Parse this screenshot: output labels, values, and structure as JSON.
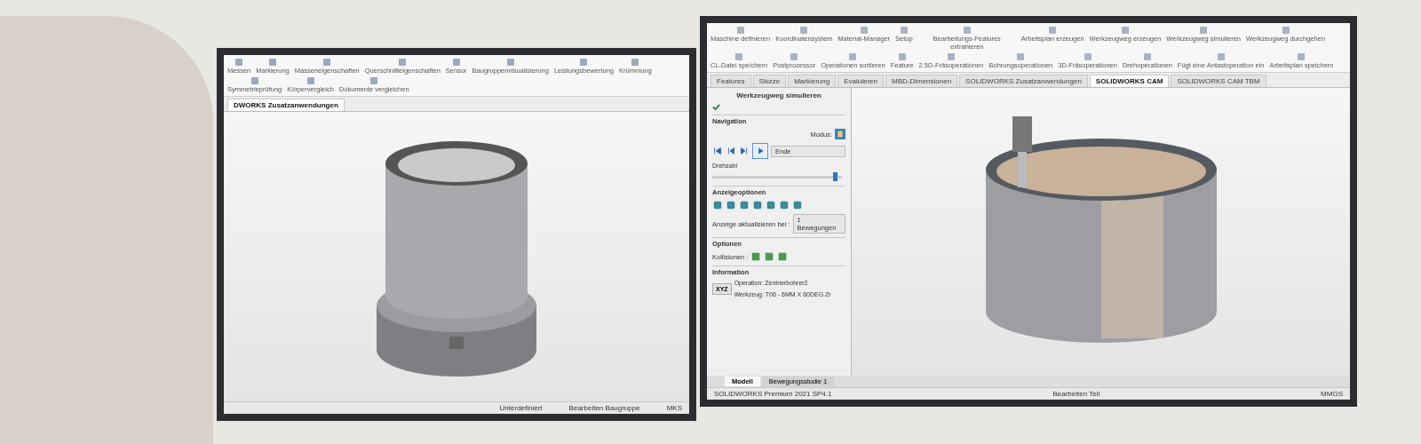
{
  "left_monitor": {
    "toolbar": [
      "Messen",
      "Markierung",
      "Masseneigenschaften",
      "Querschnitteigenschaften",
      "Sensor",
      "Baugruppenvisualisierung",
      "Leistungsbewertung",
      "Krümmung",
      "Symmetrieprüfung",
      "Körpervergleich",
      "Dokumente vergleichen"
    ],
    "tabs": [
      {
        "label": "DWORKS Zusatzanwendungen",
        "selected": true
      }
    ],
    "status_bar": [
      "Unterdefiniert",
      "Bearbeiten Baugruppe",
      "MKS"
    ]
  },
  "right_monitor": {
    "toolbar": [
      "Maschine definieren",
      "Koordinatensystem",
      "Material-Manager",
      "Setup",
      "Bearbeitungs-Features extrahieren",
      "Arbeitsplan erzeugen",
      "Werkzeugweg erzeugen",
      "Werkzeugweg simulieren",
      "Werkzeugweg durchgehen",
      "CL-Datei speichern",
      "Postprozessor",
      "Operationen sortieren",
      "Feature",
      "2.5D-Fräsoperationen",
      "Bohrungsoperationen",
      "3D-Fräsoperationen",
      "Drehoperationen",
      "Fügt eine Antastoperation ein",
      "Arbeitsplan speichern"
    ],
    "tabs": [
      {
        "label": "Features",
        "selected": false
      },
      {
        "label": "Skizze",
        "selected": false
      },
      {
        "label": "Markierung",
        "selected": false
      },
      {
        "label": "Evaluieren",
        "selected": false
      },
      {
        "label": "MBD-Dimensionen",
        "selected": false
      },
      {
        "label": "SOLIDWORKS Zusatzanwendungen",
        "selected": false
      },
      {
        "label": "SOLIDWORKS CAM",
        "selected": true
      },
      {
        "label": "SOLIDWORKS CAM TBM",
        "selected": false
      }
    ],
    "panel": {
      "title": "Werkzeugweg simulieren",
      "navigation": {
        "heading": "Navigation",
        "mode_label": "Modus:",
        "dropdown": "Ende",
        "speed_label": "Drehzahl",
        "speed": {
          "level": 0.95
        }
      },
      "display": {
        "heading": "Anzeigeoptionen",
        "update_label": "Anzeige aktualisieren bei :",
        "update_value": "1 Bewegungen"
      },
      "options": {
        "heading": "Optionen",
        "collisions_label": "Kollisionen :"
      },
      "information": {
        "heading": "Information",
        "xyz_button": "XYZ",
        "operation": "Operation: Zentrierbohrer2",
        "tool": "Werkzeug: T06 - 6MM X 60DEG Zr"
      }
    },
    "bottom_tabs": [
      {
        "label": "Modell",
        "selected": true
      },
      {
        "label": "Bewegungsstudie 1",
        "selected": false
      }
    ],
    "status_bar": [
      "SOLIDWORKS Premium 2021 SP4.1",
      "Bearbeiten Teil",
      "MMGS"
    ]
  }
}
